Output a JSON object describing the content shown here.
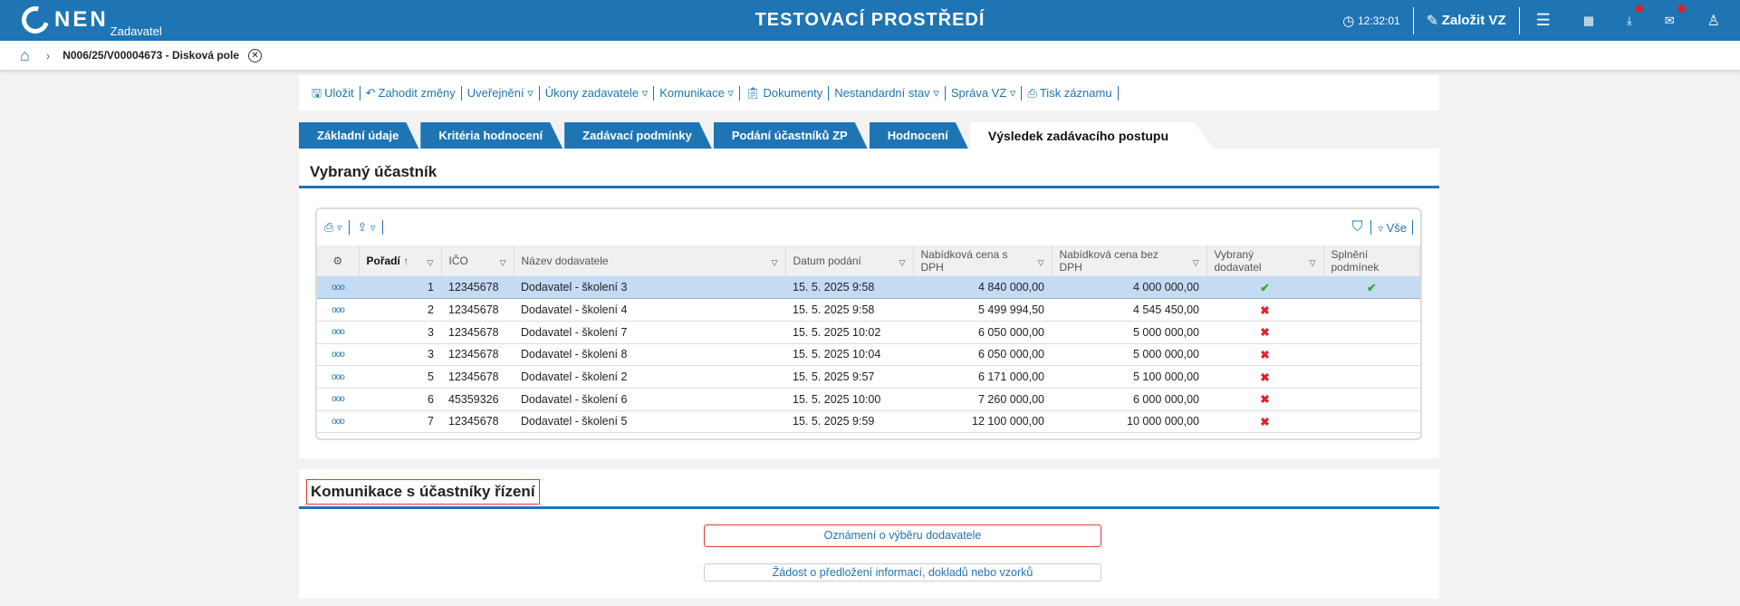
{
  "header": {
    "logo_text": "NEN",
    "logo_sub": "Zadavatel",
    "env_title": "TESTOVACÍ PROSTŘEDÍ",
    "clock": "12:32:01",
    "create_label": "Založit VZ",
    "accent": "#1f75b4"
  },
  "breadcrumb": {
    "current": "N006/25/V00004673 - Disková pole"
  },
  "toolbar": [
    "Uložit",
    "Zahodit změny",
    "Uveřejnění ▿",
    "Úkony zadavatele ▿",
    "Komunikace ▿",
    "Dokumenty",
    "Nestandardní stav ▿",
    "Správa VZ ▿",
    "Tisk záznamu"
  ],
  "tabs": [
    "Základní údaje",
    "Kritéria hodnocení",
    "Zadávací podmínky",
    "Podání účastníků ZP",
    "Hodnocení",
    "Výsledek zadávacího postupu"
  ],
  "section1": {
    "title": "Vybraný účastník",
    "filter_all": "Vše",
    "columns": [
      "Pořadí",
      "IČO",
      "Název dodavatele",
      "Datum podání",
      "Nabídková cena s DPH",
      "Nabídková cena bez DPH",
      "Vybraný dodavatel",
      "Splnění podmínek"
    ],
    "rows": [
      {
        "rank": "1",
        "ico": "12345678",
        "name": "Dodavatel - školení 3",
        "date": "15. 5. 2025 9:58",
        "vat": "4 840 000,00",
        "novat": "4 000 000,00",
        "selected": "✔",
        "cond": "✔"
      },
      {
        "rank": "2",
        "ico": "12345678",
        "name": "Dodavatel - školení 4",
        "date": "15. 5. 2025 9:58",
        "vat": "5 499 994,50",
        "novat": "4 545 450,00",
        "selected": "✖",
        "cond": ""
      },
      {
        "rank": "3",
        "ico": "12345678",
        "name": "Dodavatel - školení 7",
        "date": "15. 5. 2025 10:02",
        "vat": "6 050 000,00",
        "novat": "5 000 000,00",
        "selected": "✖",
        "cond": ""
      },
      {
        "rank": "3",
        "ico": "12345678",
        "name": "Dodavatel - školení 8",
        "date": "15. 5. 2025 10:04",
        "vat": "6 050 000,00",
        "novat": "5 000 000,00",
        "selected": "✖",
        "cond": ""
      },
      {
        "rank": "5",
        "ico": "12345678",
        "name": "Dodavatel - školení 2",
        "date": "15. 5. 2025 9:57",
        "vat": "6 171 000,00",
        "novat": "5 100 000,00",
        "selected": "✖",
        "cond": ""
      },
      {
        "rank": "6",
        "ico": "45359326",
        "name": "Dodavatel - školení 6",
        "date": "15. 5. 2025 10:00",
        "vat": "7 260 000,00",
        "novat": "6 000 000,00",
        "selected": "✖",
        "cond": ""
      },
      {
        "rank": "7",
        "ico": "12345678",
        "name": "Dodavatel - školení 5",
        "date": "15. 5. 2025 9:59",
        "vat": "12 100 000,00",
        "novat": "10 000 000,00",
        "selected": "✖",
        "cond": ""
      }
    ]
  },
  "section2": {
    "title": "Komunikace s účastníky řízení",
    "buttons": [
      "Oznámení o výběru dodavatele",
      "Žádost o předložení informací, dokladů nebo vzorků"
    ]
  }
}
